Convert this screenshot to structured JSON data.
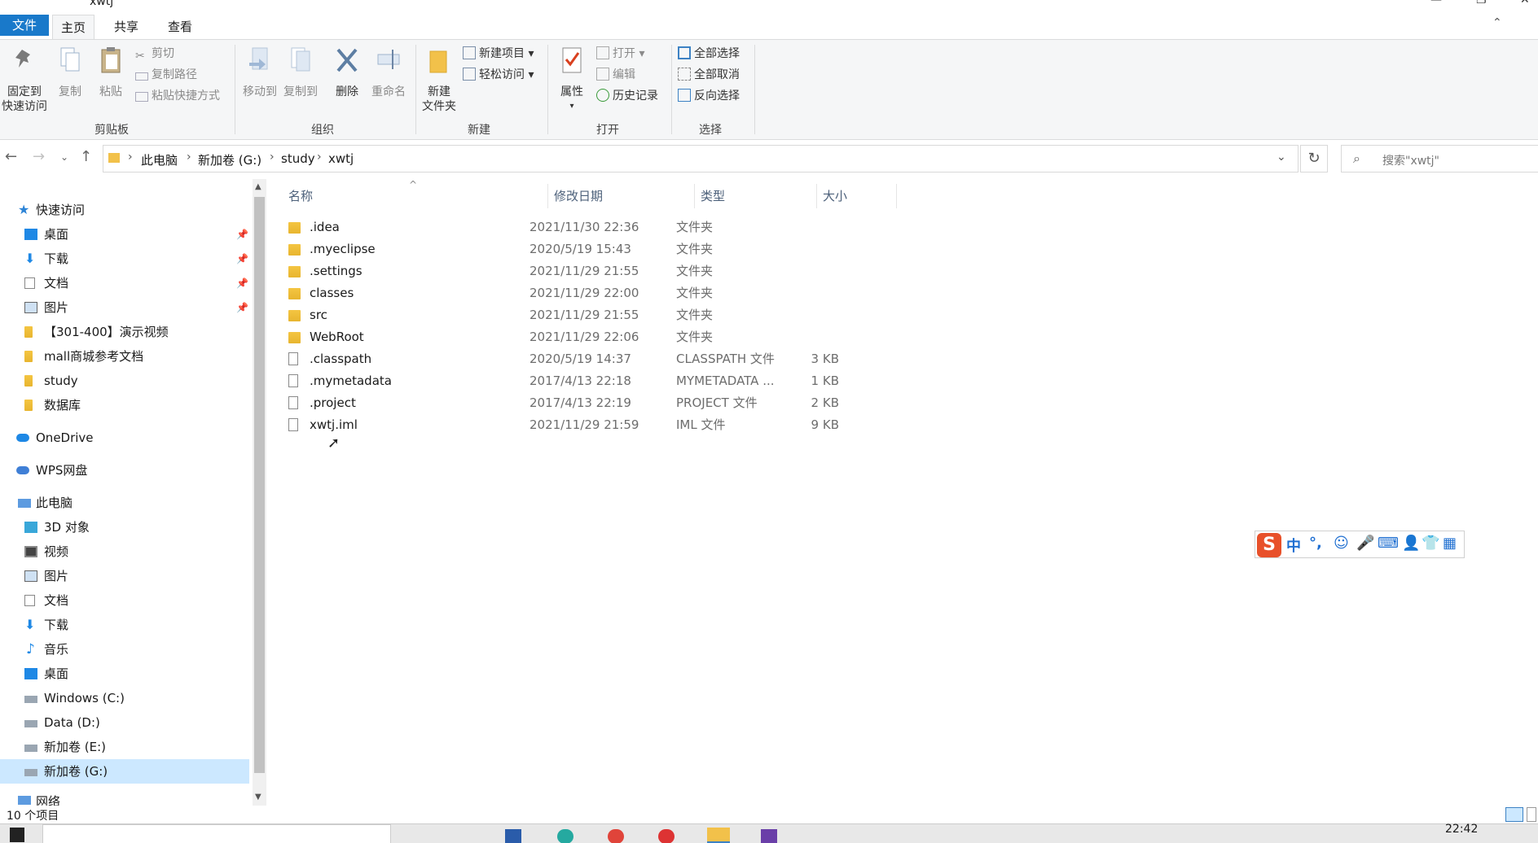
{
  "window": {
    "title": "xwtj",
    "minimize": "—",
    "maximize": "❐",
    "close": "✕"
  },
  "ribbon_tabs": [
    "文件",
    "主页",
    "共享",
    "查看"
  ],
  "ribbon": {
    "clipboard": {
      "pin_line1": "固定到",
      "pin_line2": "快速访问",
      "copy": "复制",
      "paste": "粘贴",
      "cut": "剪切",
      "copy_path": "复制路径",
      "paste_shortcut": "粘贴快捷方式",
      "group": "剪贴板"
    },
    "organize": {
      "move_to": "移动到",
      "copy_to": "复制到",
      "delete": "删除",
      "rename": "重命名",
      "group": "组织"
    },
    "new": {
      "new_folder_line1": "新建",
      "new_folder_line2": "文件夹",
      "new_item": "新建项目 ▾",
      "easy_access": "轻松访问 ▾",
      "group": "新建"
    },
    "open": {
      "properties": "属性",
      "open": "打开 ▾",
      "edit": "编辑",
      "history": "历史记录",
      "group": "打开"
    },
    "select": {
      "select_all": "全部选择",
      "select_none": "全部取消",
      "invert": "反向选择",
      "group": "选择"
    }
  },
  "address": {
    "crumbs": [
      "此电脑",
      "新加卷 (G:)",
      "study",
      "xwtj"
    ],
    "search_placeholder": "搜索\"xwtj\""
  },
  "nav": {
    "quick_access": "快速访问",
    "quick_items": [
      "桌面",
      "下载",
      "文档",
      "图片",
      "【301-400】演示视频",
      "mall商城参考文档",
      "study",
      "数据库"
    ],
    "onedrive": "OneDrive",
    "wps": "WPS网盘",
    "this_pc": "此电脑",
    "pc_items": [
      "3D 对象",
      "视频",
      "图片",
      "文档",
      "下载",
      "音乐",
      "桌面",
      "Windows (C:)",
      "Data (D:)",
      "新加卷 (E:)",
      "新加卷 (G:)"
    ],
    "network": "网络"
  },
  "columns": {
    "name": "名称",
    "date": "修改日期",
    "type": "类型",
    "size": "大小"
  },
  "files": [
    {
      "name": ".idea",
      "date": "2021/11/30 22:36",
      "type": "文件夹",
      "size": "",
      "kind": "folder"
    },
    {
      "name": ".myeclipse",
      "date": "2020/5/19 15:43",
      "type": "文件夹",
      "size": "",
      "kind": "folder"
    },
    {
      "name": ".settings",
      "date": "2021/11/29 21:55",
      "type": "文件夹",
      "size": "",
      "kind": "folder"
    },
    {
      "name": "classes",
      "date": "2021/11/29 22:00",
      "type": "文件夹",
      "size": "",
      "kind": "folder"
    },
    {
      "name": "src",
      "date": "2021/11/29 21:55",
      "type": "文件夹",
      "size": "",
      "kind": "folder"
    },
    {
      "name": "WebRoot",
      "date": "2021/11/29 22:06",
      "type": "文件夹",
      "size": "",
      "kind": "folder"
    },
    {
      "name": ".classpath",
      "date": "2020/5/19 14:37",
      "type": "CLASSPATH 文件",
      "size": "3 KB",
      "kind": "file"
    },
    {
      "name": ".mymetadata",
      "date": "2017/4/13 22:18",
      "type": "MYMETADATA ...",
      "size": "1 KB",
      "kind": "file"
    },
    {
      "name": ".project",
      "date": "2017/4/13 22:19",
      "type": "PROJECT 文件",
      "size": "2 KB",
      "kind": "file"
    },
    {
      "name": "xwtj.iml",
      "date": "2021/11/29 21:59",
      "type": "IML 文件",
      "size": "9 KB",
      "kind": "file"
    }
  ],
  "status": {
    "count": "10 个项目"
  },
  "taskbar": {
    "clock": "22:42"
  },
  "ime": {
    "logo": "S",
    "mode": "中",
    "punct": "°,"
  }
}
